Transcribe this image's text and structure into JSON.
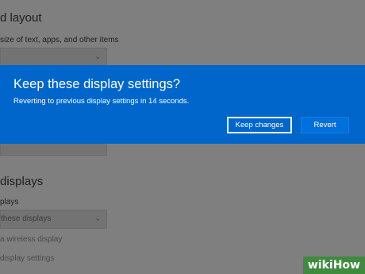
{
  "background": {
    "section1_heading": "d layout",
    "section1_sub": "size of text, apps, and other items",
    "section2_heading": "displays",
    "section2_sub": "plays",
    "dropdown_value": "these displays",
    "link1": "a wireless display",
    "link2": "display settings"
  },
  "dialog": {
    "title": "Keep these display settings?",
    "message": "Reverting to previous display settings in 14 seconds.",
    "keep_label": "Keep changes",
    "revert_label": "Revert"
  },
  "watermark": {
    "text": "wikiHow"
  },
  "colors": {
    "accent": "#0066cc",
    "overlay": "#7f7f7f",
    "watermark": "#3f8a3f"
  }
}
